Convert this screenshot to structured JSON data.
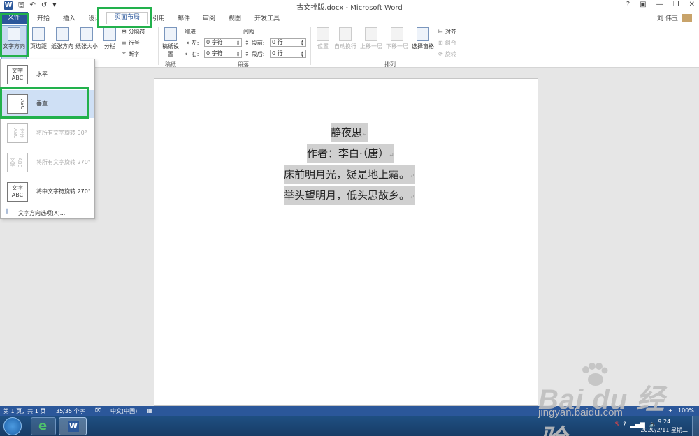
{
  "titlebar": {
    "title": "古文排版.docx - Microsoft Word",
    "help": "?",
    "ribbon_opts": "▣",
    "minimize": "—",
    "restore": "❐",
    "close": "✕"
  },
  "qat": {
    "word": "W",
    "save": "🖫",
    "undo": "↶",
    "redo": "↺",
    "more": "▾"
  },
  "tabs": {
    "file": "文件",
    "home": "开始",
    "insert": "插入",
    "design": "设计",
    "layout": "页面布局",
    "references": "引用",
    "mailings": "邮件",
    "review": "审阅",
    "view": "视图",
    "developer": "开发工具"
  },
  "user": {
    "name": "刘 伟玉"
  },
  "ribbon": {
    "text_direction": "文字方向",
    "margins": "页边距",
    "orientation": "纸张方向",
    "size": "纸张大小",
    "columns": "分栏",
    "breaks": "分隔符",
    "line_numbers": "行号",
    "hyphenation": "断字",
    "draft_paper": "稿纸设置",
    "group_draft": "稿纸",
    "indent_title": "缩进",
    "spacing_title": "间距",
    "indent_left_label": "左:",
    "indent_right_label": "右:",
    "indent_left_value": "0 字符",
    "indent_right_value": "0 字符",
    "spacing_before_label": "段前:",
    "spacing_after_label": "段后:",
    "spacing_before_value": "0 行",
    "spacing_after_value": "0 行",
    "group_paragraph": "段落",
    "position": "位置",
    "wrap_text": "自动换行",
    "bring_forward": "上移一层",
    "send_backward": "下移一层",
    "selection_pane": "选择窗格",
    "align": "对齐",
    "group": "组合",
    "rotate": "旋转",
    "group_arrange": "排列"
  },
  "dropdown": {
    "items": [
      {
        "preview": "文字\nABC",
        "label": "水平"
      },
      {
        "preview": "ABC",
        "label": "垂直"
      },
      {
        "preview": "文字ABC",
        "label": "将所有文字旋转 90°"
      },
      {
        "preview": "文字ABC",
        "label": "将所有文字旋转 270°"
      },
      {
        "preview": "文字\nABC",
        "label": "将中文字符旋转 270°"
      }
    ],
    "options": "文字方向选项(X)..."
  },
  "document": {
    "lines": [
      "静夜思",
      "作者：李白·（唐）",
      "床前明月光，疑是地上霜。",
      "举头望明月，低头思故乡。"
    ],
    "para_mark": "↵"
  },
  "status": {
    "page": "第 1 页，共 1 页",
    "words": "35/35 个字",
    "lang": "中文(中国)",
    "zoom": "100%",
    "zoom_plus": "+"
  },
  "taskbar": {
    "time": "9:24",
    "date": "2020/2/11 星期二"
  },
  "watermark": {
    "brand": "Bai du 经验",
    "site": "jingyan.baidu.com"
  }
}
